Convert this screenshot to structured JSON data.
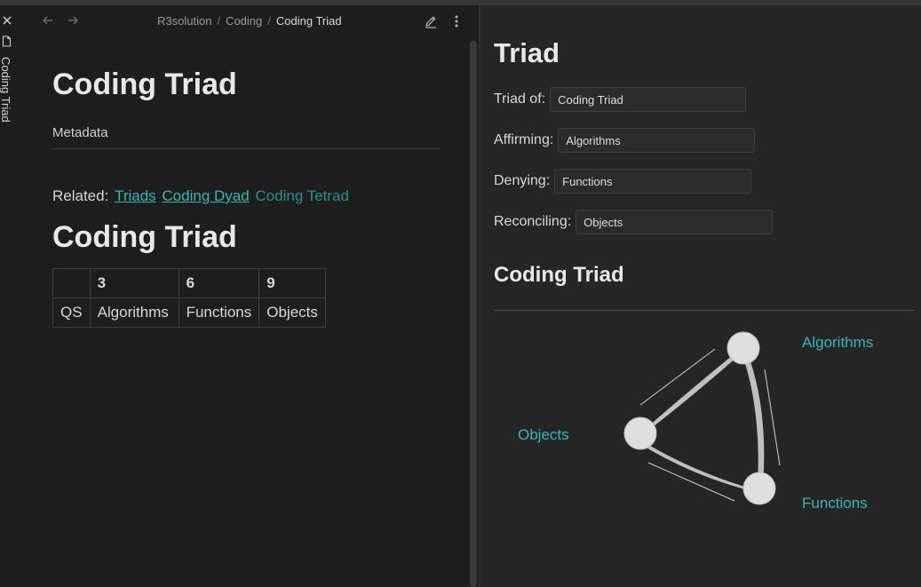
{
  "tab": {
    "label": "Coding Triad"
  },
  "breadcrumb": {
    "root": "R3solution",
    "folder": "Coding",
    "current": "Coding Triad"
  },
  "note": {
    "title": "Coding Triad",
    "metadata_label": "Metadata",
    "related_label": "Related:",
    "related_links": [
      "Triads",
      "Coding Dyad",
      "Coding Tetrad"
    ],
    "section_title": "Coding Triad",
    "table": {
      "header": [
        "",
        "3",
        "6",
        "9"
      ],
      "rows": [
        [
          "QS",
          "Algorithms",
          "Functions",
          "Objects"
        ]
      ]
    }
  },
  "panel": {
    "title": "Triad",
    "fields": [
      {
        "label": "Triad of:",
        "value": "Coding Triad"
      },
      {
        "label": "Affirming:",
        "value": "Algorithms"
      },
      {
        "label": "Denying:",
        "value": "Functions"
      },
      {
        "label": "Reconciling:",
        "value": "Objects"
      }
    ],
    "graph_title": "Coding Triad",
    "graph_labels": {
      "top": "Algorithms",
      "left": "Objects",
      "bottom": "Functions"
    }
  },
  "colors": {
    "accent": "#3fb3b3",
    "background": "#1e1e1e",
    "panel": "#262626"
  },
  "icons": [
    "close-icon",
    "file-icon",
    "back-arrow-icon",
    "forward-arrow-icon",
    "edit-icon",
    "more-options-icon"
  ]
}
